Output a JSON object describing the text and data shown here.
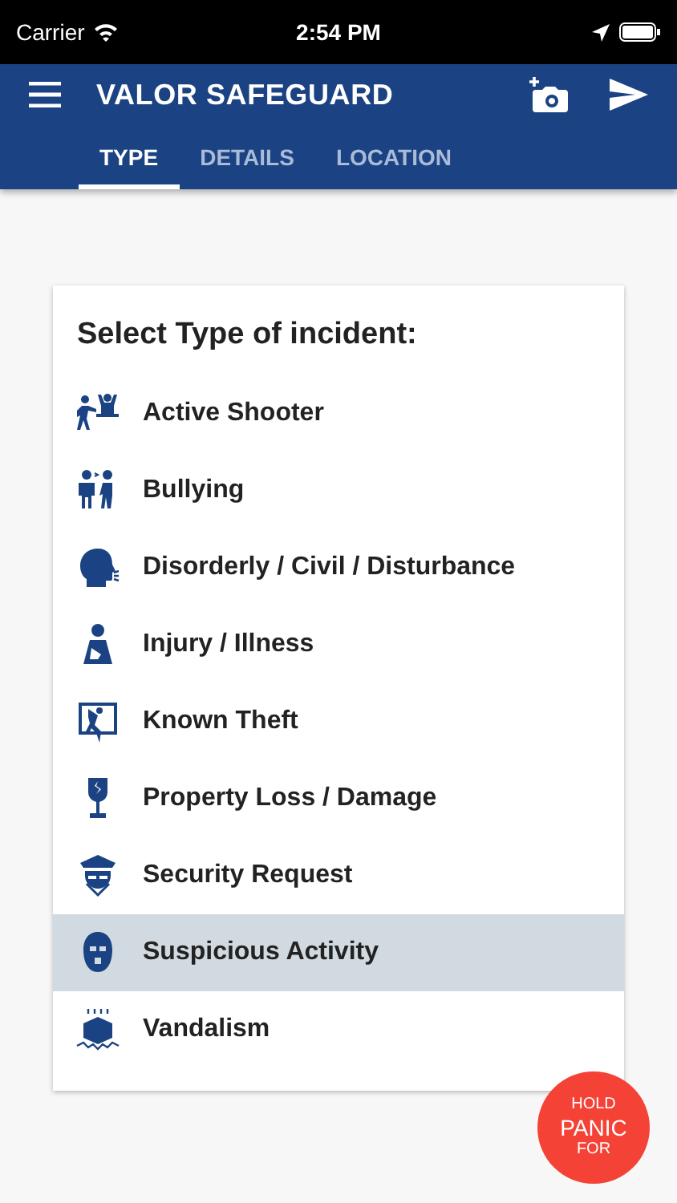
{
  "status_bar": {
    "carrier": "Carrier",
    "time": "2:54 PM"
  },
  "app_bar": {
    "title": "VALOR SAFEGUARD"
  },
  "tabs": [
    {
      "label": "TYPE",
      "selected": true
    },
    {
      "label": "DETAILS",
      "selected": false
    },
    {
      "label": "LOCATION",
      "selected": false
    }
  ],
  "card": {
    "heading": "Select Type of incident:",
    "items": [
      {
        "label": "Active Shooter",
        "selected": false
      },
      {
        "label": "Bullying",
        "selected": false
      },
      {
        "label": "Disorderly / Civil / Disturbance",
        "selected": false
      },
      {
        "label": "Injury / Illness",
        "selected": false
      },
      {
        "label": "Known Theft",
        "selected": false
      },
      {
        "label": "Property Loss / Damage",
        "selected": false
      },
      {
        "label": "Security Request",
        "selected": false
      },
      {
        "label": "Suspicious Activity",
        "selected": true
      },
      {
        "label": "Vandalism",
        "selected": false
      }
    ]
  },
  "panic_button": {
    "top": "HOLD",
    "main": "PANIC",
    "bottom": "FOR"
  }
}
